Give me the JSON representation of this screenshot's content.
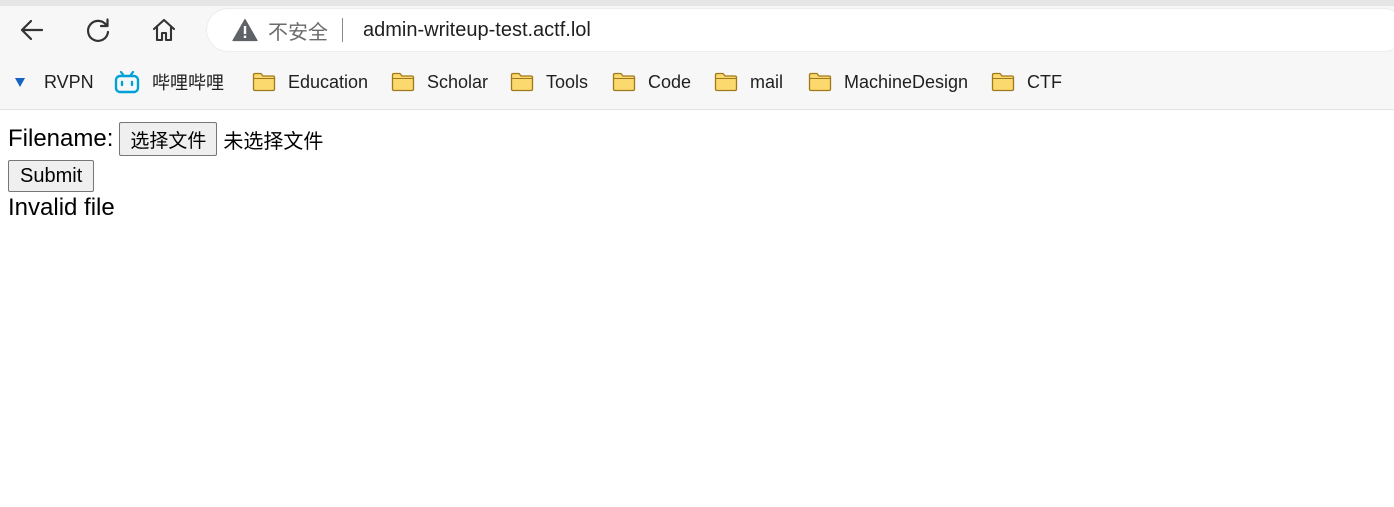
{
  "browser": {
    "security_label": "不安全",
    "url": "admin-writeup-test.actf.lol",
    "bookmarks": [
      {
        "label": "RVPN",
        "icon": "triangle-down-icon"
      },
      {
        "label": "哔哩哔哩",
        "icon": "bilibili-icon"
      },
      {
        "label": "Education",
        "icon": "folder-icon"
      },
      {
        "label": "Scholar",
        "icon": "folder-icon"
      },
      {
        "label": "Tools",
        "icon": "folder-icon"
      },
      {
        "label": "Code",
        "icon": "folder-icon"
      },
      {
        "label": "mail",
        "icon": "folder-icon"
      },
      {
        "label": "MachineDesign",
        "icon": "folder-icon"
      },
      {
        "label": "CTF",
        "icon": "folder-icon"
      }
    ],
    "colors": {
      "folder_fill": "#fbd96e",
      "folder_stroke": "#a07a1a",
      "bilibili_blue": "#00a1d6",
      "rvpn_blue": "#1565c0"
    }
  },
  "form": {
    "filename_label": "Filename:",
    "choose_file_label": "选择文件",
    "no_file_text": "未选择文件",
    "submit_label": "Submit"
  },
  "result": {
    "message": "Invalid file"
  }
}
